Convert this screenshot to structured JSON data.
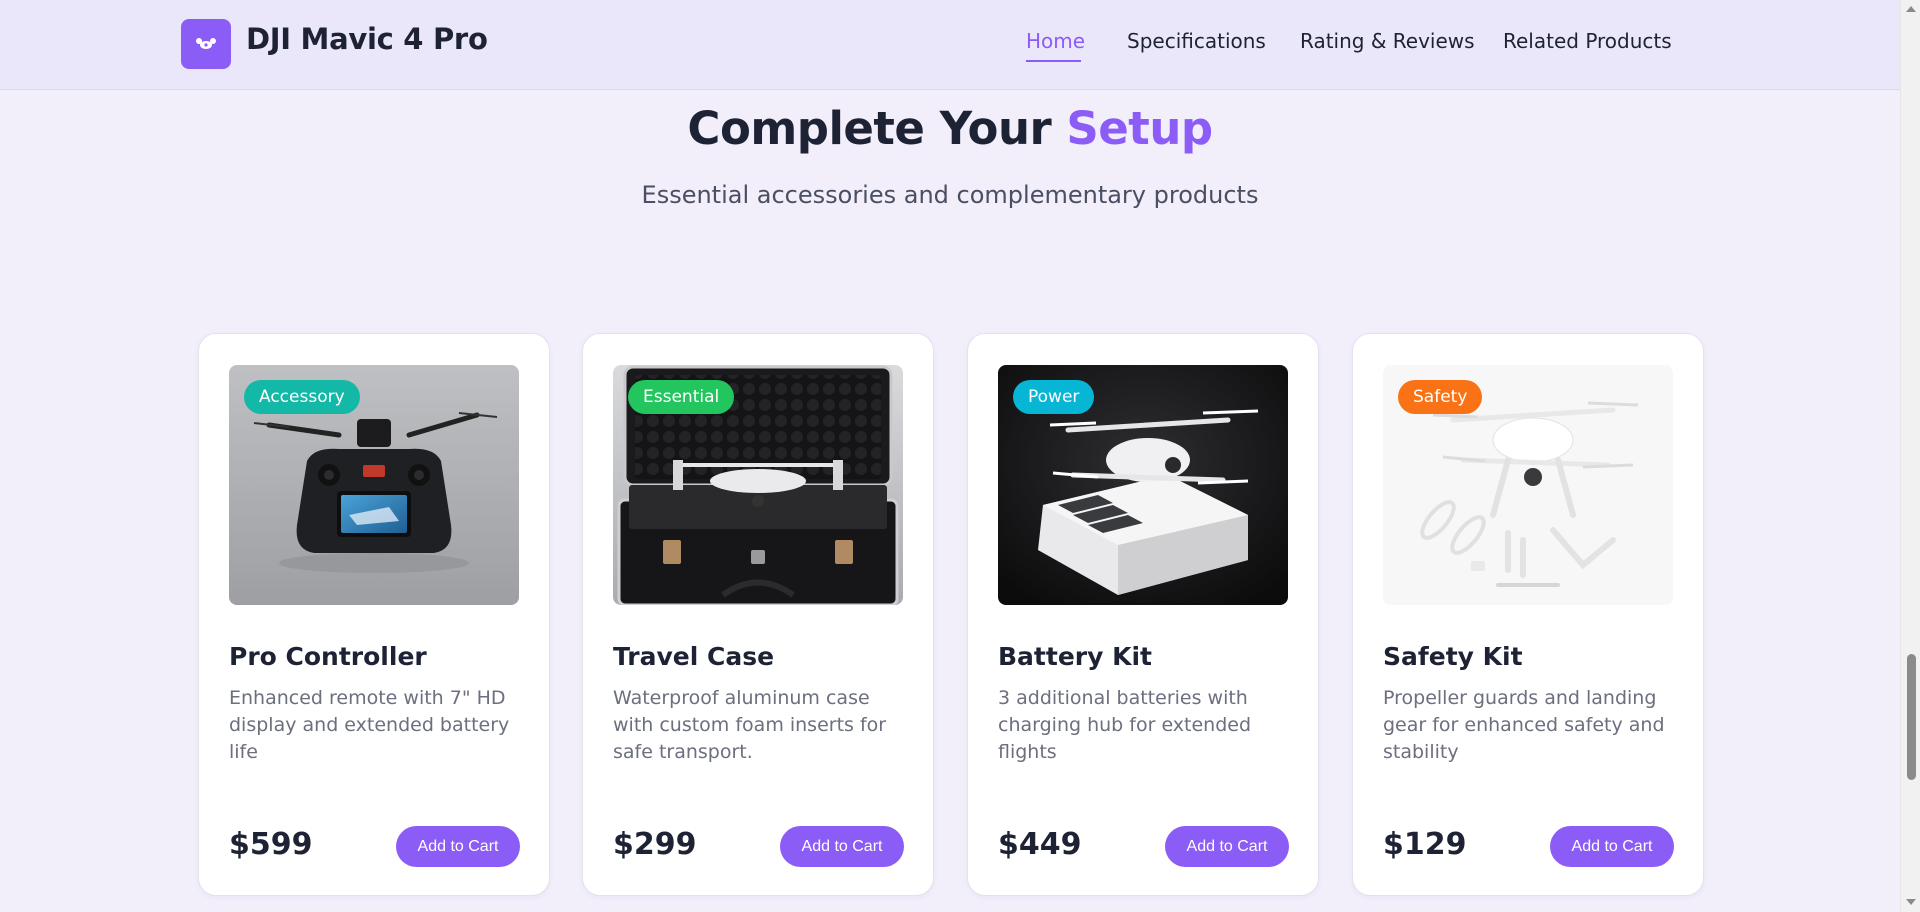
{
  "header": {
    "brand": "DJI Mavic 4 Pro",
    "logo_icon": "drone-icon",
    "nav": [
      {
        "label": "Home",
        "active": true
      },
      {
        "label": "Specifications",
        "active": false
      },
      {
        "label": "Rating & Reviews",
        "active": false
      },
      {
        "label": "Related Products",
        "active": false
      }
    ]
  },
  "section": {
    "title_main": "Complete Your ",
    "title_accent": "Setup",
    "subtitle": "Essential accessories and complementary products"
  },
  "products": [
    {
      "badge": "Accessory",
      "badge_color": "#14b8a6",
      "title": "Pro Controller",
      "desc": "Enhanced remote with 7\" HD display and extended battery life",
      "price": "$599",
      "button": "Add to Cart",
      "image": "controller-image"
    },
    {
      "badge": "Essential",
      "badge_color": "#22c55e",
      "title": "Travel Case",
      "desc": "Waterproof aluminum case with custom foam inserts for safe transport.",
      "price": "$299",
      "button": "Add to Cart",
      "image": "travel-case-image"
    },
    {
      "badge": "Power",
      "badge_color": "#06b6d4",
      "title": "Battery Kit",
      "desc": "3 additional batteries with charging hub for extended flights",
      "price": "$449",
      "button": "Add to Cart",
      "image": "battery-kit-image"
    },
    {
      "badge": "Safety",
      "badge_color": "#f97316",
      "title": "Safety Kit",
      "desc": "Propeller guards and landing gear for enhanced safety and stability",
      "price": "$129",
      "button": "Add to Cart",
      "image": "safety-kit-image"
    }
  ],
  "colors": {
    "accent": "#8b5cf6",
    "page_bg": "#f2effb",
    "header_bg": "#ebe7fa"
  }
}
